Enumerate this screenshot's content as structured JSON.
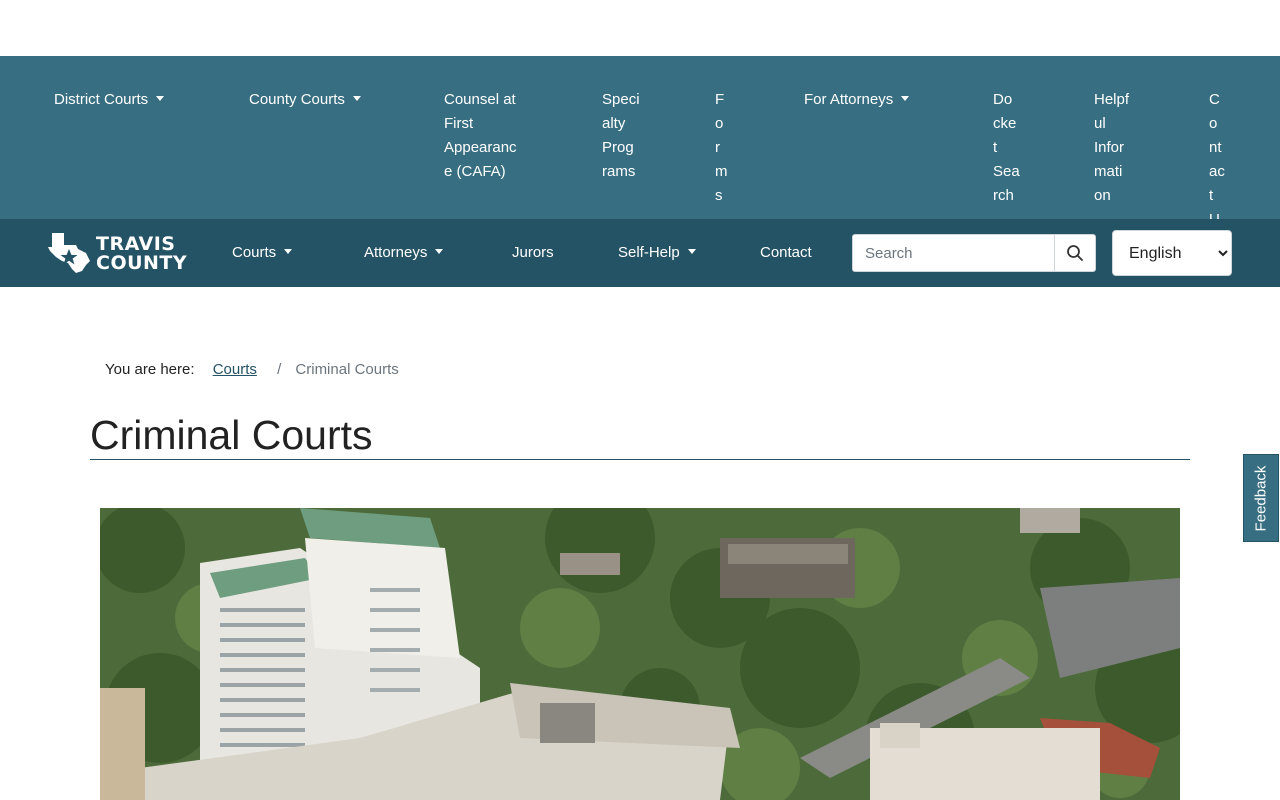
{
  "court_nav": {
    "items": [
      {
        "label": "District Courts",
        "has_menu": true,
        "lines": [
          "District Courts"
        ]
      },
      {
        "label": "County Courts",
        "has_menu": true,
        "lines": [
          "County Courts"
        ]
      },
      {
        "label": "Counsel at First Appearance (CAFA)",
        "has_menu": false,
        "lines": [
          "Counsel at",
          "First",
          "Appearanc",
          "e (CAFA)"
        ]
      },
      {
        "label": "Specialty Programs",
        "has_menu": false,
        "lines": [
          "Speci",
          "alty",
          "Prog",
          "rams"
        ]
      },
      {
        "label": "Forms",
        "has_menu": false,
        "lines": [
          "F",
          "o",
          "r",
          "m",
          "s"
        ]
      },
      {
        "label": "For Attorneys",
        "has_menu": true,
        "lines": [
          "For Attorneys"
        ]
      },
      {
        "label": "Docket Search",
        "has_menu": false,
        "lines": [
          "Do",
          "cke",
          "t",
          "Sea",
          "rch"
        ]
      },
      {
        "label": "Helpful Information",
        "has_menu": false,
        "lines": [
          "Helpf",
          "ul",
          "Infor",
          "mati",
          "on"
        ]
      },
      {
        "label": "Contact Us",
        "has_menu": false,
        "lines": [
          "C",
          "o",
          "nt",
          "ac",
          "t",
          "U"
        ]
      }
    ]
  },
  "main_nav": {
    "logo_line1": "TRAVIS",
    "logo_line2": "COUNTY",
    "items": [
      {
        "label": "Courts",
        "has_menu": true
      },
      {
        "label": "Attorneys",
        "has_menu": true
      },
      {
        "label": "Jurors",
        "has_menu": false
      },
      {
        "label": "Self-Help",
        "has_menu": true
      },
      {
        "label": "Contact",
        "has_menu": false
      }
    ],
    "search_placeholder": "Search",
    "language_selected": "English"
  },
  "breadcrumb": {
    "prefix": "You are here:",
    "link": "Courts",
    "separator": "/",
    "current": "Criminal Courts"
  },
  "page": {
    "title": "Criminal Courts"
  },
  "feedback_label": "Feedback",
  "colors": {
    "court_nav_bg": "#376e81",
    "main_nav_bg": "#245365",
    "link": "#245365"
  }
}
